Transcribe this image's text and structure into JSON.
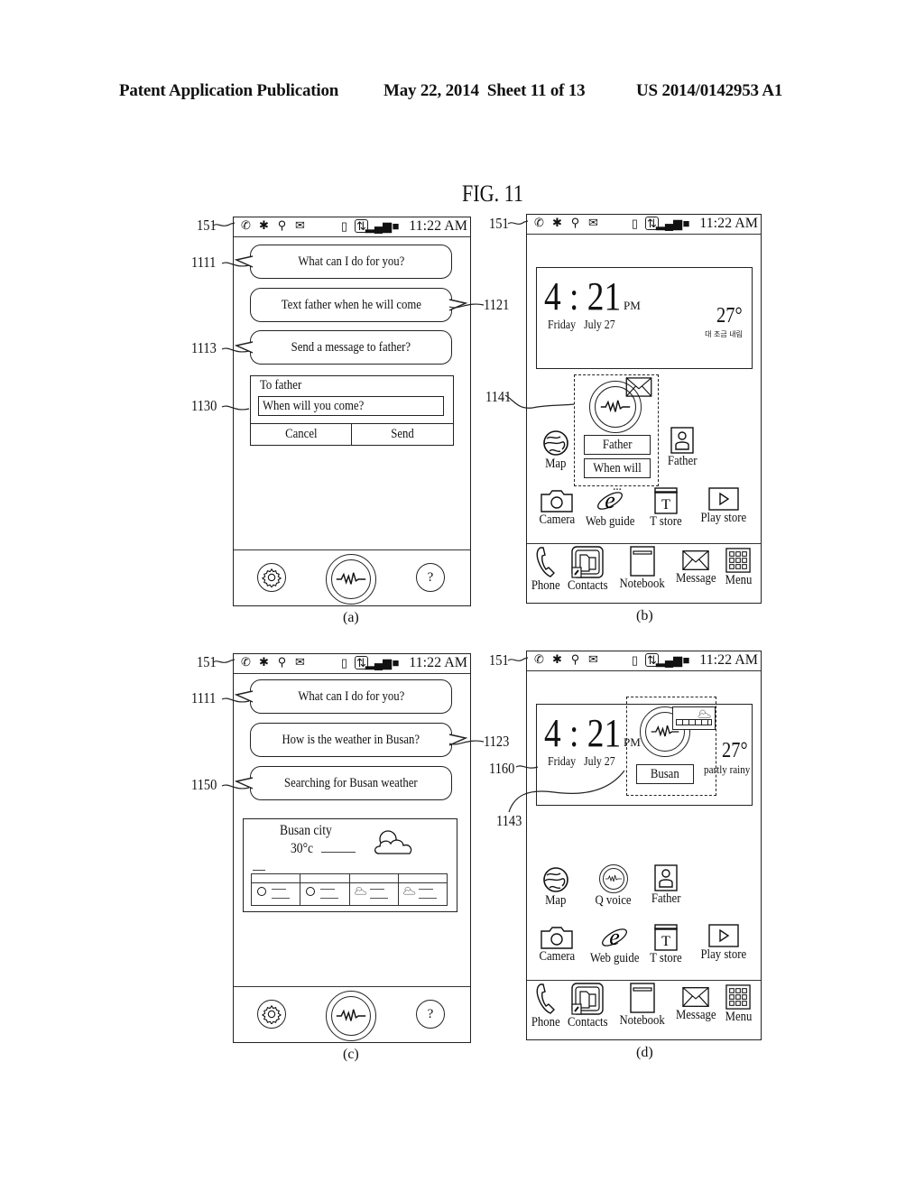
{
  "header": {
    "publication": "Patent Application Publication",
    "date_sheet": "May 22, 2014  Sheet 11 of 13",
    "number": "US 2014/0142953 A1"
  },
  "figure_title": "FIG. 11",
  "status_bar": {
    "time": "11:22 AM",
    "left_icons": [
      "phone-icon",
      "bug-icon",
      "usb-icon",
      "mail-icon"
    ],
    "right_icons": [
      "vibrate-icon",
      "data-transfer-icon",
      "signal-icon",
      "battery-icon"
    ]
  },
  "panels": {
    "a": {
      "caption": "(a)",
      "refs": {
        "status": "151",
        "bubble1": "1111",
        "bubble2": "1121",
        "bubble3": "1113",
        "dialog": "1130"
      },
      "bubbles": [
        "What can I do for you?",
        "Text father when he will come",
        "Send a message to father?"
      ],
      "dialog": {
        "recipient": "To father",
        "message": "When will you come?",
        "cancel": "Cancel",
        "send": "Send"
      },
      "bottom_icons": [
        "settings-icon",
        "voice-icon",
        "help-icon"
      ],
      "help_label": "?"
    },
    "b": {
      "caption": "(b)",
      "refs": {
        "status": "151",
        "widget": "1141"
      },
      "clock": {
        "time": "4 : 21",
        "ampm": "PM",
        "day": "Friday",
        "date": "July 27",
        "temp": "27°",
        "weather_desc": "대 조금 내림"
      },
      "widget": {
        "name": "Father",
        "preview": "When will ..."
      },
      "apps_row1": [
        {
          "label": "Map",
          "icon": "globe-icon"
        },
        {
          "label": "Father",
          "icon": "person-icon"
        }
      ],
      "apps_row2": [
        {
          "label": "Camera",
          "icon": "camera-icon"
        },
        {
          "label": "Web guide",
          "icon": "browser-icon"
        },
        {
          "label": "T store",
          "icon": "store-icon"
        },
        {
          "label": "Play store",
          "icon": "play-icon"
        }
      ],
      "dock": [
        {
          "label": "Phone",
          "icon": "phone-icon"
        },
        {
          "label": "Contacts",
          "icon": "contacts-icon"
        },
        {
          "label": "Notebook",
          "icon": "notebook-icon"
        },
        {
          "label": "Message",
          "icon": "mail-icon"
        },
        {
          "label": "Menu",
          "icon": "grid-icon"
        }
      ]
    },
    "c": {
      "caption": "(c)",
      "refs": {
        "status": "151",
        "bubble1": "1111",
        "bubble2": "1123",
        "bubble3": "1150"
      },
      "bubbles": [
        "What can I do for you?",
        "How is the weather in Busan?",
        "Searching for Busan weather"
      ],
      "weather": {
        "city": "Busan city",
        "temp": "30°c",
        "forecast_icons": [
          "sun-icon",
          "sun-icon",
          "cloud-icon",
          "cloud-icon"
        ]
      },
      "bottom_icons": [
        "settings-icon",
        "voice-icon",
        "help-icon"
      ],
      "help_label": "?"
    },
    "d": {
      "caption": "(d)",
      "refs": {
        "status": "151",
        "clock": "1160",
        "widget": "1143"
      },
      "clock": {
        "time": "4 : 21",
        "ampm": "PM",
        "day": "Friday",
        "date": "July 27",
        "temp": "27°",
        "weather_desc": "partly rainy"
      },
      "widget": {
        "name": "Busan"
      },
      "apps_row1": [
        {
          "label": "Map",
          "icon": "globe-icon"
        },
        {
          "label": "Q voice",
          "icon": "voice-icon"
        },
        {
          "label": "Father",
          "icon": "person-icon"
        }
      ],
      "apps_row2": [
        {
          "label": "Camera",
          "icon": "camera-icon"
        },
        {
          "label": "Web guide",
          "icon": "browser-icon"
        },
        {
          "label": "T store",
          "icon": "store-icon"
        },
        {
          "label": "Play store",
          "icon": "play-icon"
        }
      ],
      "dock": [
        {
          "label": "Phone",
          "icon": "phone-icon"
        },
        {
          "label": "Contacts",
          "icon": "contacts-icon"
        },
        {
          "label": "Notebook",
          "icon": "notebook-icon"
        },
        {
          "label": "Message",
          "icon": "mail-icon"
        },
        {
          "label": "Menu",
          "icon": "grid-icon"
        }
      ]
    }
  }
}
